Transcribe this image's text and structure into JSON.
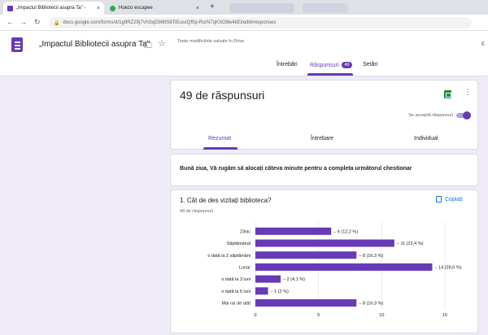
{
  "browser": {
    "tabs": [
      {
        "label": "„Impactul Bibliotecii asupra Ta\" - ",
        "close": "×"
      },
      {
        "label": "Hoezo escapee",
        "close": "×"
      }
    ],
    "new_tab": "+",
    "url": "docs.google.com/forms/d/1g9RZ29j7VhSqD9i8tS8TiEusxQf0p-RsrN7qKSO8w4kEi/edit#responses"
  },
  "header": {
    "title": "„Impactul Bibliotecii asupra Ta\"",
    "save_status": "Toate modificările salvate în Drive",
    "tabs": [
      {
        "label": "Întrebări"
      },
      {
        "label": "Răspunsuri",
        "badge": "49"
      },
      {
        "label": "Setări"
      }
    ]
  },
  "summary_card": {
    "title": "49 de răspunsuri",
    "accepting_label": "Se acceptă răspunsuri",
    "subtabs": [
      "Rezumat",
      "Întrebare",
      "Individual"
    ]
  },
  "description": "Bună ziua, Vă rugăm să alocați câteva minute pentru a completa următorul chestionar",
  "question": {
    "title": "1. Cât de des vizitați biblioteca?",
    "count": "49 de răspunsuri",
    "copy_label": "Copiați"
  },
  "colors": {
    "accent": "#673ab7",
    "bar": "#673ab7",
    "background": "#f0ebf8"
  },
  "chart_data": {
    "type": "bar",
    "orientation": "horizontal",
    "categories": [
      "Zilnic",
      "Săptămânal",
      "o dată la 2 săptămâni",
      "Lunar",
      "o dată la 3 luni",
      "o dată la 6 luni",
      "Mai rar de atât"
    ],
    "values": [
      6,
      11,
      8,
      14,
      2,
      1,
      8
    ],
    "value_labels": [
      "6 (12,2 %)",
      "11 (22,4 %)",
      "8 (16,3 %)",
      "14 (28,6 %)",
      "2 (4,1 %)",
      "1 (2 %)",
      "8 (16,3 %)"
    ],
    "xlim": [
      0,
      15
    ],
    "xticks": [
      0,
      5,
      10,
      15
    ],
    "grid": true
  }
}
